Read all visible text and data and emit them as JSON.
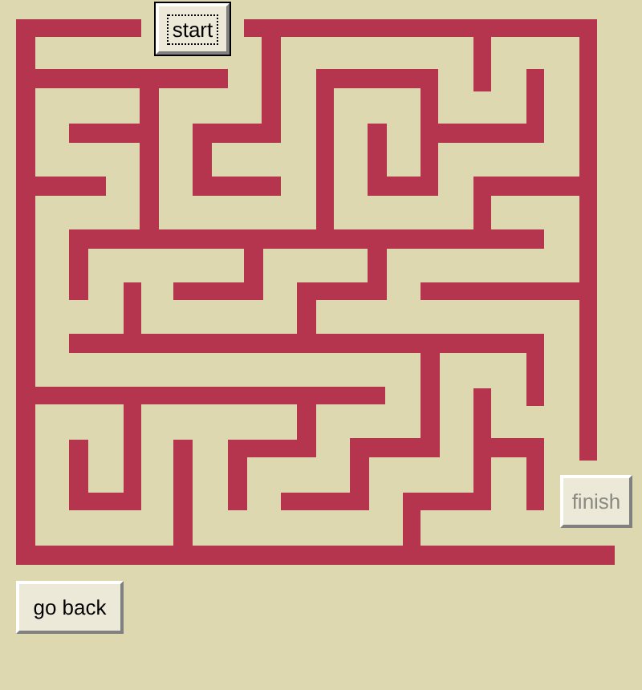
{
  "start_button": {
    "label": "start",
    "focused": true,
    "disabled": false
  },
  "finish_button": {
    "label": "finish",
    "focused": false,
    "disabled": true
  },
  "back_button": {
    "label": "go back",
    "focused": false,
    "disabled": false
  }
}
